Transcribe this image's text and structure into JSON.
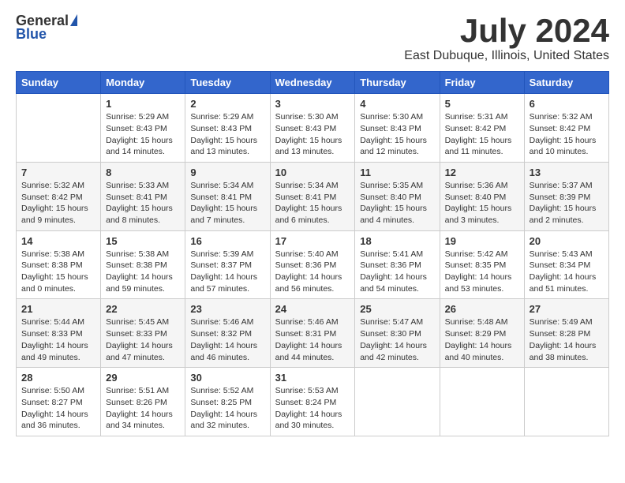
{
  "header": {
    "logo_general": "General",
    "logo_blue": "Blue",
    "month": "July 2024",
    "location": "East Dubuque, Illinois, United States"
  },
  "columns": [
    "Sunday",
    "Monday",
    "Tuesday",
    "Wednesday",
    "Thursday",
    "Friday",
    "Saturday"
  ],
  "weeks": [
    [
      {
        "day": "",
        "info": ""
      },
      {
        "day": "1",
        "info": "Sunrise: 5:29 AM\nSunset: 8:43 PM\nDaylight: 15 hours\nand 14 minutes."
      },
      {
        "day": "2",
        "info": "Sunrise: 5:29 AM\nSunset: 8:43 PM\nDaylight: 15 hours\nand 13 minutes."
      },
      {
        "day": "3",
        "info": "Sunrise: 5:30 AM\nSunset: 8:43 PM\nDaylight: 15 hours\nand 13 minutes."
      },
      {
        "day": "4",
        "info": "Sunrise: 5:30 AM\nSunset: 8:43 PM\nDaylight: 15 hours\nand 12 minutes."
      },
      {
        "day": "5",
        "info": "Sunrise: 5:31 AM\nSunset: 8:42 PM\nDaylight: 15 hours\nand 11 minutes."
      },
      {
        "day": "6",
        "info": "Sunrise: 5:32 AM\nSunset: 8:42 PM\nDaylight: 15 hours\nand 10 minutes."
      }
    ],
    [
      {
        "day": "7",
        "info": "Sunrise: 5:32 AM\nSunset: 8:42 PM\nDaylight: 15 hours\nand 9 minutes."
      },
      {
        "day": "8",
        "info": "Sunrise: 5:33 AM\nSunset: 8:41 PM\nDaylight: 15 hours\nand 8 minutes."
      },
      {
        "day": "9",
        "info": "Sunrise: 5:34 AM\nSunset: 8:41 PM\nDaylight: 15 hours\nand 7 minutes."
      },
      {
        "day": "10",
        "info": "Sunrise: 5:34 AM\nSunset: 8:41 PM\nDaylight: 15 hours\nand 6 minutes."
      },
      {
        "day": "11",
        "info": "Sunrise: 5:35 AM\nSunset: 8:40 PM\nDaylight: 15 hours\nand 4 minutes."
      },
      {
        "day": "12",
        "info": "Sunrise: 5:36 AM\nSunset: 8:40 PM\nDaylight: 15 hours\nand 3 minutes."
      },
      {
        "day": "13",
        "info": "Sunrise: 5:37 AM\nSunset: 8:39 PM\nDaylight: 15 hours\nand 2 minutes."
      }
    ],
    [
      {
        "day": "14",
        "info": "Sunrise: 5:38 AM\nSunset: 8:38 PM\nDaylight: 15 hours\nand 0 minutes."
      },
      {
        "day": "15",
        "info": "Sunrise: 5:38 AM\nSunset: 8:38 PM\nDaylight: 14 hours\nand 59 minutes."
      },
      {
        "day": "16",
        "info": "Sunrise: 5:39 AM\nSunset: 8:37 PM\nDaylight: 14 hours\nand 57 minutes."
      },
      {
        "day": "17",
        "info": "Sunrise: 5:40 AM\nSunset: 8:36 PM\nDaylight: 14 hours\nand 56 minutes."
      },
      {
        "day": "18",
        "info": "Sunrise: 5:41 AM\nSunset: 8:36 PM\nDaylight: 14 hours\nand 54 minutes."
      },
      {
        "day": "19",
        "info": "Sunrise: 5:42 AM\nSunset: 8:35 PM\nDaylight: 14 hours\nand 53 minutes."
      },
      {
        "day": "20",
        "info": "Sunrise: 5:43 AM\nSunset: 8:34 PM\nDaylight: 14 hours\nand 51 minutes."
      }
    ],
    [
      {
        "day": "21",
        "info": "Sunrise: 5:44 AM\nSunset: 8:33 PM\nDaylight: 14 hours\nand 49 minutes."
      },
      {
        "day": "22",
        "info": "Sunrise: 5:45 AM\nSunset: 8:33 PM\nDaylight: 14 hours\nand 47 minutes."
      },
      {
        "day": "23",
        "info": "Sunrise: 5:46 AM\nSunset: 8:32 PM\nDaylight: 14 hours\nand 46 minutes."
      },
      {
        "day": "24",
        "info": "Sunrise: 5:46 AM\nSunset: 8:31 PM\nDaylight: 14 hours\nand 44 minutes."
      },
      {
        "day": "25",
        "info": "Sunrise: 5:47 AM\nSunset: 8:30 PM\nDaylight: 14 hours\nand 42 minutes."
      },
      {
        "day": "26",
        "info": "Sunrise: 5:48 AM\nSunset: 8:29 PM\nDaylight: 14 hours\nand 40 minutes."
      },
      {
        "day": "27",
        "info": "Sunrise: 5:49 AM\nSunset: 8:28 PM\nDaylight: 14 hours\nand 38 minutes."
      }
    ],
    [
      {
        "day": "28",
        "info": "Sunrise: 5:50 AM\nSunset: 8:27 PM\nDaylight: 14 hours\nand 36 minutes."
      },
      {
        "day": "29",
        "info": "Sunrise: 5:51 AM\nSunset: 8:26 PM\nDaylight: 14 hours\nand 34 minutes."
      },
      {
        "day": "30",
        "info": "Sunrise: 5:52 AM\nSunset: 8:25 PM\nDaylight: 14 hours\nand 32 minutes."
      },
      {
        "day": "31",
        "info": "Sunrise: 5:53 AM\nSunset: 8:24 PM\nDaylight: 14 hours\nand 30 minutes."
      },
      {
        "day": "",
        "info": ""
      },
      {
        "day": "",
        "info": ""
      },
      {
        "day": "",
        "info": ""
      }
    ]
  ]
}
